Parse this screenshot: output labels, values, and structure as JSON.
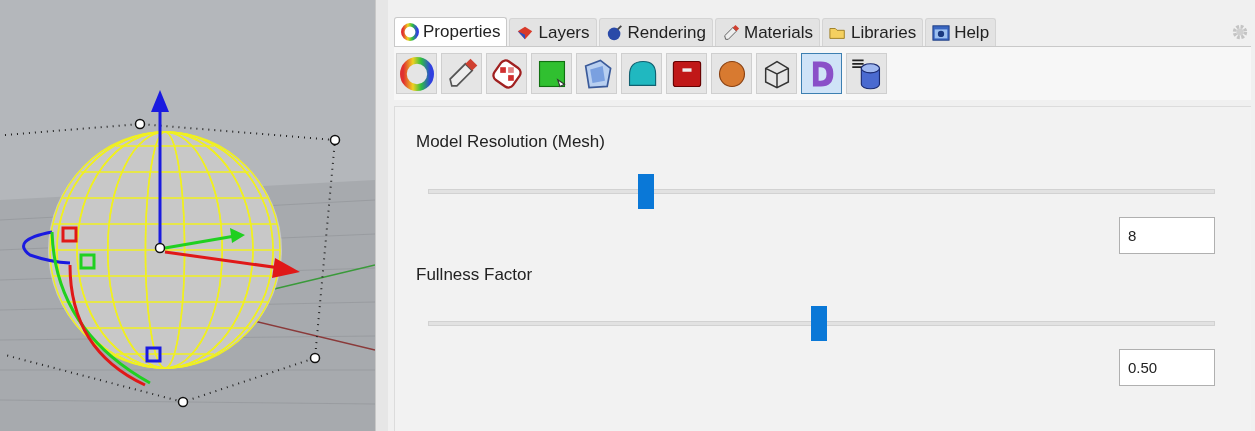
{
  "tabs": [
    {
      "label": "Properties",
      "kind": "wheel",
      "selected": true
    },
    {
      "label": "Layers",
      "kind": "layers",
      "selected": false
    },
    {
      "label": "Rendering",
      "kind": "ball",
      "selected": false
    },
    {
      "label": "Materials",
      "kind": "tube",
      "selected": false
    },
    {
      "label": "Libraries",
      "kind": "folder",
      "selected": false
    },
    {
      "label": "Help",
      "kind": "help",
      "selected": false
    }
  ],
  "toolbar": [
    {
      "kind": "wheel",
      "selected": false
    },
    {
      "kind": "tube",
      "selected": false
    },
    {
      "kind": "texture",
      "selected": false
    },
    {
      "kind": "square",
      "selected": false
    },
    {
      "kind": "cube",
      "selected": false
    },
    {
      "kind": "blob",
      "selected": false
    },
    {
      "kind": "box",
      "selected": false
    },
    {
      "kind": "orange",
      "selected": false
    },
    {
      "kind": "wireframe",
      "selected": false
    },
    {
      "kind": "letter",
      "selected": true
    },
    {
      "kind": "cylinder",
      "selected": false
    }
  ],
  "sliders": [
    {
      "label": "Model Resolution (Mesh)",
      "level": 0.277,
      "value": "8"
    },
    {
      "label": "Fullness Factor",
      "level": 0.497,
      "value": "0.50"
    }
  ]
}
